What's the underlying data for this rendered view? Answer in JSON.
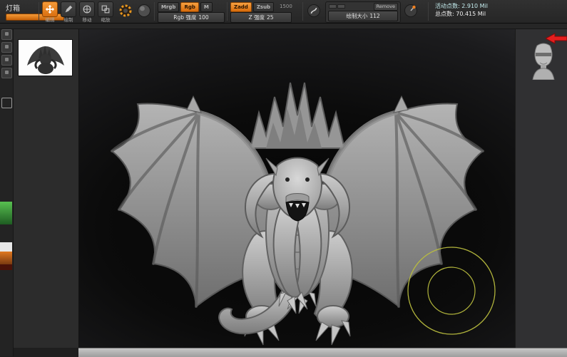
{
  "colors": {
    "accent_orange": "#e8781e",
    "brush_circle": "#b9bd3e",
    "stats_cyan": "#c4ecee",
    "arrow_red": "#e41e1e",
    "swatch_green": "#4caf50",
    "swatch_white": "#e8e8e8",
    "swatch_orange": "#d4751f"
  },
  "topbar": {
    "lightbox_label": "灯箱",
    "tools": [
      {
        "label": "编辑",
        "active": true
      },
      {
        "label": "绘制",
        "active": false
      },
      {
        "label": "移动",
        "active": false
      },
      {
        "label": "缩放",
        "active": false
      }
    ],
    "paint_modes": [
      {
        "label": "Mrgb",
        "active": false
      },
      {
        "label": "Rgb",
        "active": true
      },
      {
        "label": "M",
        "active": false
      }
    ],
    "rgb_intensity_label": "Rgb 强度",
    "rgb_intensity_value": "100",
    "sculpt_modes": [
      {
        "label": "Zadd",
        "active": true
      },
      {
        "label": "Zsub",
        "active": false
      }
    ],
    "z_limit_value": "1500",
    "z_intensity_label": "Z 强度",
    "z_intensity_value": "25",
    "draw_size_label": "绘制大小",
    "draw_size_value": "112",
    "remove_label": "Remove",
    "stats": {
      "active_points": "活动点数: 2.910 Mil",
      "total_points": "总点数: 70.415 Mil"
    }
  },
  "viewport": {
    "model": "dragon-sculpt",
    "brush_cursor": {
      "outer_radius": 61,
      "inner_radius": 33
    }
  }
}
